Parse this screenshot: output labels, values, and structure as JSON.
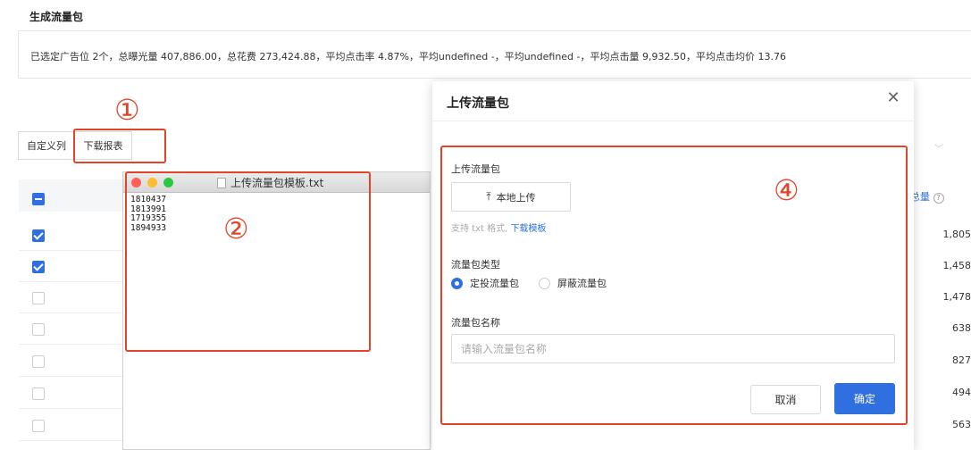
{
  "page": {
    "title": "生成流量包",
    "summary": "已选定广告位 2个，总曝光量 407,886.00，总花费 273,424.88，平均点击率 4.87%，平均undefined -，平均undefined -，平均点击量 9,932.50，平均点击均价 13.76"
  },
  "annotations": [
    "①",
    "②",
    "④"
  ],
  "toolbar": {
    "custom_columns": "自定义列",
    "download_report": "下载报表"
  },
  "table": {
    "rows_checked": [
      true,
      true,
      false,
      false,
      false,
      false,
      false
    ],
    "right_column_header": "总量",
    "right_column_values": [
      "1,805",
      "1,458",
      "1,478",
      "638",
      "827",
      "494",
      "563"
    ]
  },
  "text_file": {
    "title": "上传流量包模板.txt",
    "lines": [
      "1810437",
      "1813991",
      "1719355",
      "1894933"
    ]
  },
  "modal": {
    "title": "上传流量包",
    "upload_label": "上传流量包",
    "upload_button": "本地上传",
    "hint_text": "支持 txt 格式,",
    "hint_link": "下载模板",
    "type_label": "流量包类型",
    "type_options": [
      "定投流量包",
      "屏蔽流量包"
    ],
    "type_selected": "定投流量包",
    "name_label": "流量包名称",
    "name_placeholder": "请输入流量包名称",
    "cancel": "取消",
    "confirm": "确定"
  },
  "colors": {
    "accent": "#2f6fe0",
    "annotation": "#e0452a"
  }
}
